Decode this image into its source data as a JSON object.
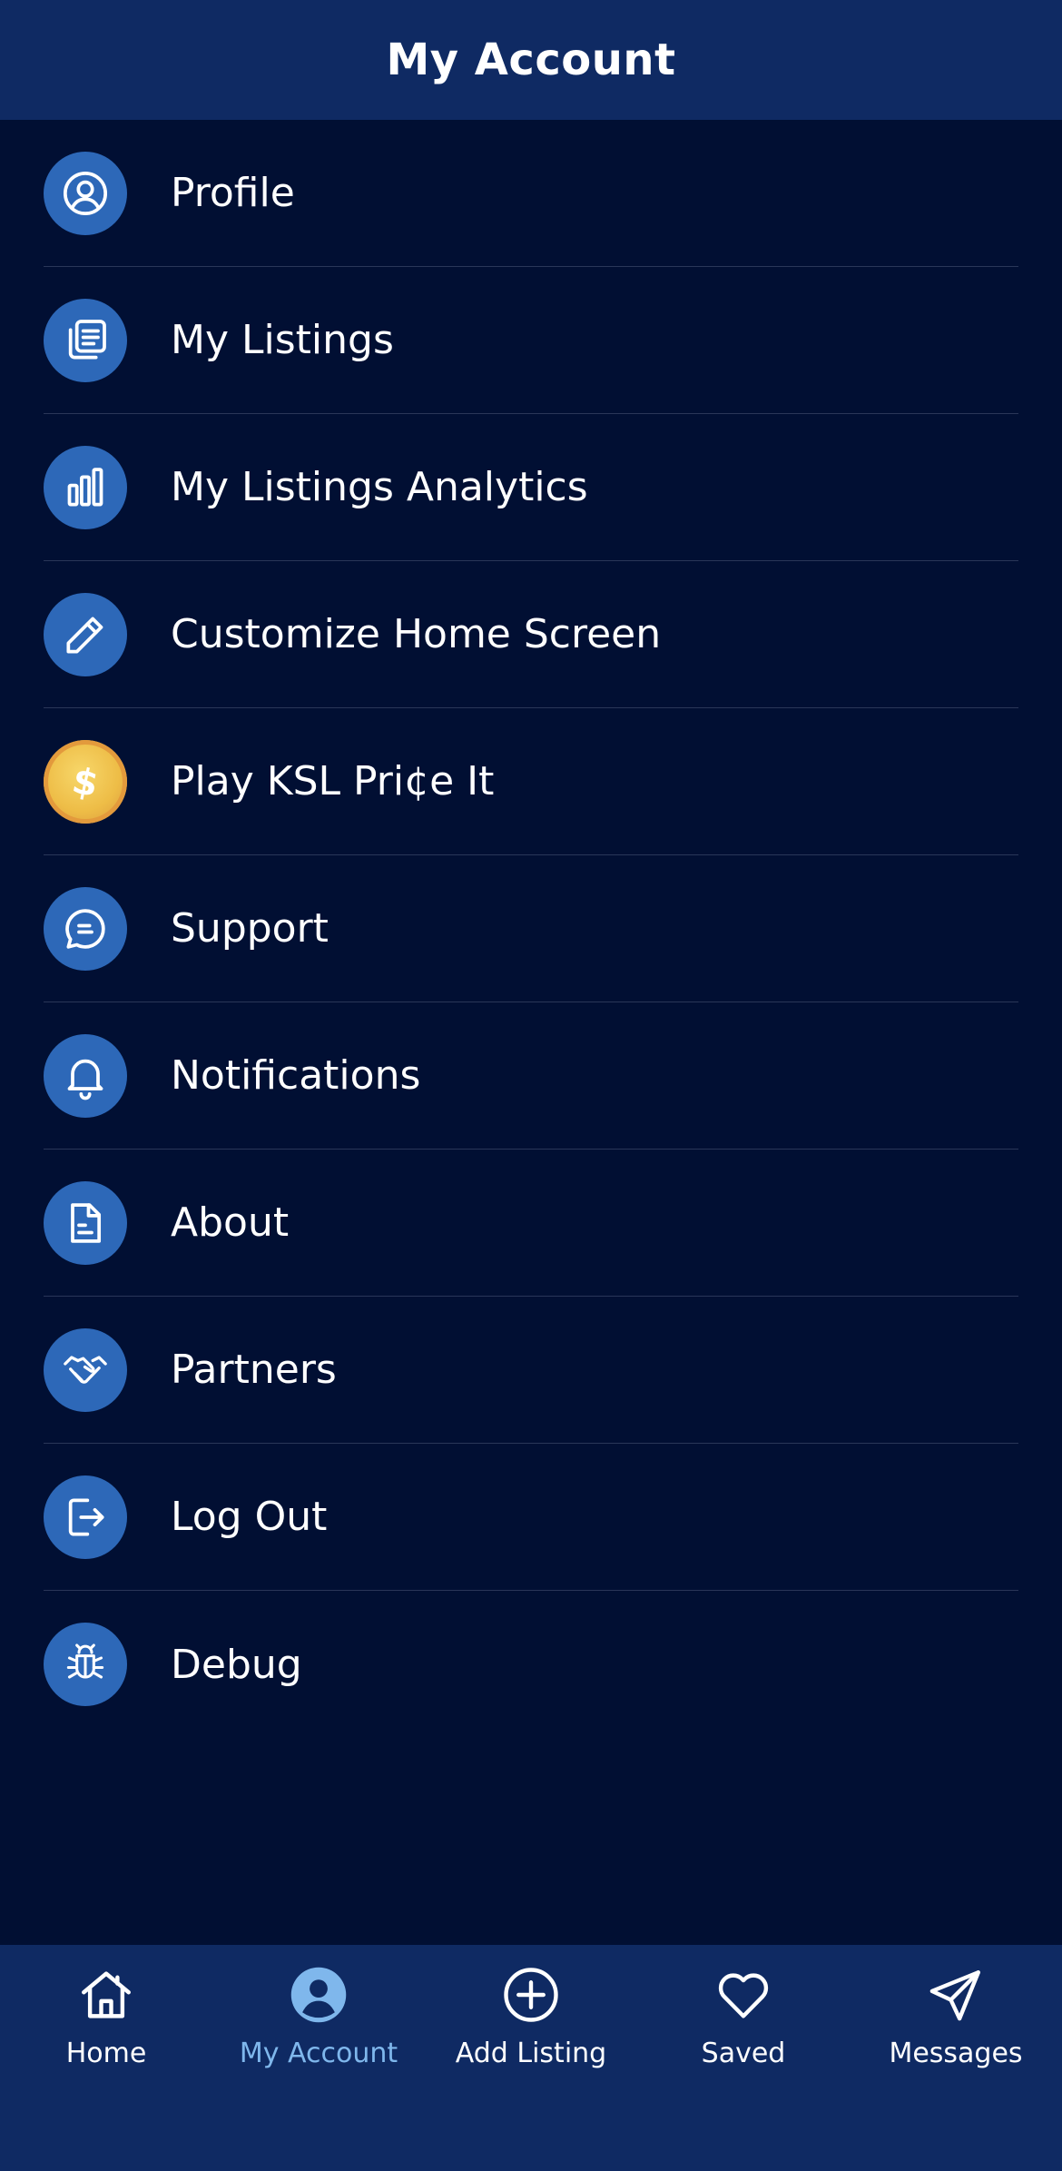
{
  "header": {
    "title": "My Account"
  },
  "menu": [
    {
      "label": "Profile",
      "icon": "user-circle-icon"
    },
    {
      "label": "My Listings",
      "icon": "listings-icon"
    },
    {
      "label": "My Listings Analytics",
      "icon": "bar-chart-icon"
    },
    {
      "label": "Customize Home Screen",
      "icon": "pencil-icon"
    },
    {
      "label": "Play KSL Pri¢e It",
      "icon": "dollar-coin-icon"
    },
    {
      "label": "Support",
      "icon": "chat-bubble-icon"
    },
    {
      "label": "Notifications",
      "icon": "bell-icon"
    },
    {
      "label": "About",
      "icon": "document-icon"
    },
    {
      "label": "Partners",
      "icon": "handshake-icon"
    },
    {
      "label": "Log Out",
      "icon": "logout-icon"
    },
    {
      "label": "Debug",
      "icon": "bug-icon"
    }
  ],
  "tabbar": {
    "tabs": [
      {
        "label": "Home",
        "icon": "home-icon",
        "active": false
      },
      {
        "label": "My Account",
        "icon": "account-icon",
        "active": true
      },
      {
        "label": "Add Listing",
        "icon": "plus-circle-icon",
        "active": false
      },
      {
        "label": "Saved",
        "icon": "heart-icon",
        "active": false
      },
      {
        "label": "Messages",
        "icon": "paper-plane-icon",
        "active": false
      }
    ]
  },
  "colors": {
    "background": "#010f33",
    "header": "#0f2a63",
    "icon_circle": "#2d68b8",
    "active_tab": "#7fb7ec",
    "divider": "#2a3658",
    "coin": "#eebd47"
  }
}
